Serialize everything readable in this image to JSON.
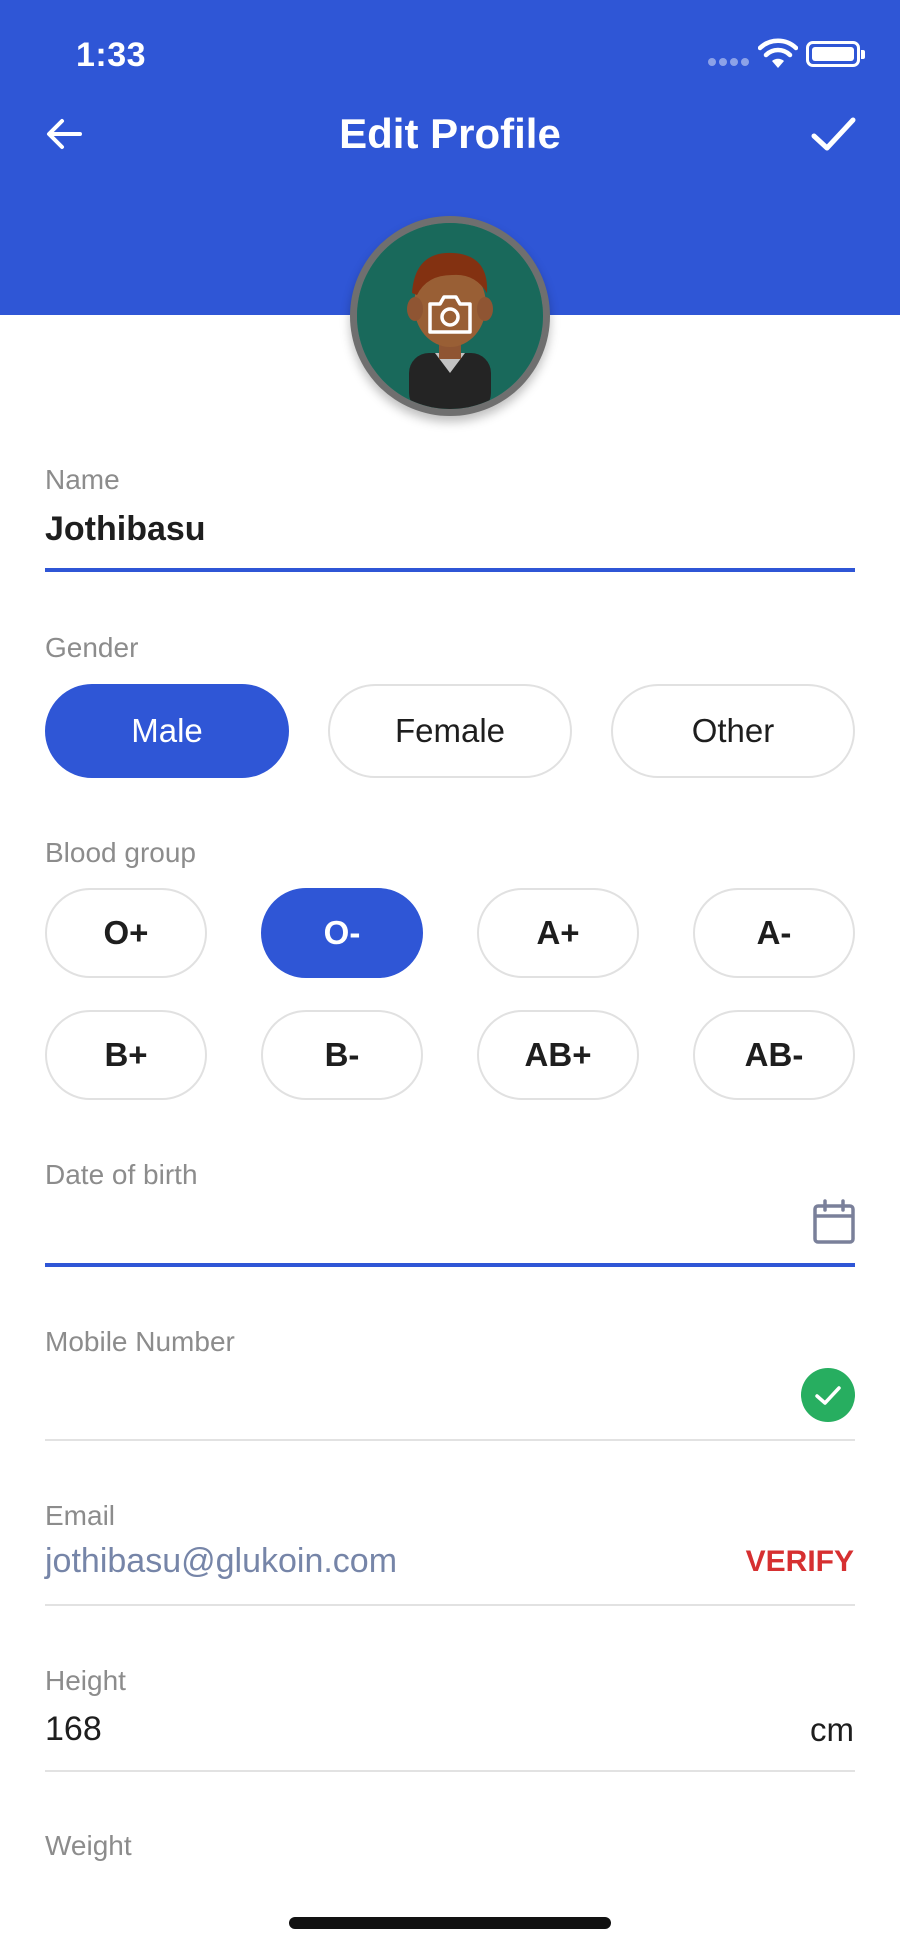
{
  "status_bar": {
    "time": "1:33"
  },
  "header": {
    "title": "Edit Profile",
    "back_icon": "arrow-left-icon",
    "save_icon": "check-icon",
    "background_color": "#2f56d6"
  },
  "avatar": {
    "icon": "camera-icon"
  },
  "name": {
    "label": "Name",
    "value": "Jothibasu"
  },
  "gender": {
    "label": "Gender",
    "options": [
      "Male",
      "Female",
      "Other"
    ],
    "selected": "Male"
  },
  "blood_group": {
    "label": "Blood group",
    "options": [
      "O+",
      "O-",
      "A+",
      "A-",
      "B+",
      "B-",
      "AB+",
      "AB-"
    ],
    "selected": "O-"
  },
  "date_of_birth": {
    "label": "Date of birth",
    "value": "",
    "icon": "calendar-icon"
  },
  "mobile": {
    "label": "Mobile Number",
    "value": "",
    "status_icon": "verified-check-icon",
    "status_color": "#27ae60"
  },
  "email": {
    "label": "Email",
    "value": "jothibasu@glukoin.com",
    "action": "VERIFY",
    "action_color": "#d63031"
  },
  "height": {
    "label": "Height",
    "value": "168",
    "unit": "cm"
  },
  "weight": {
    "label": "Weight"
  }
}
